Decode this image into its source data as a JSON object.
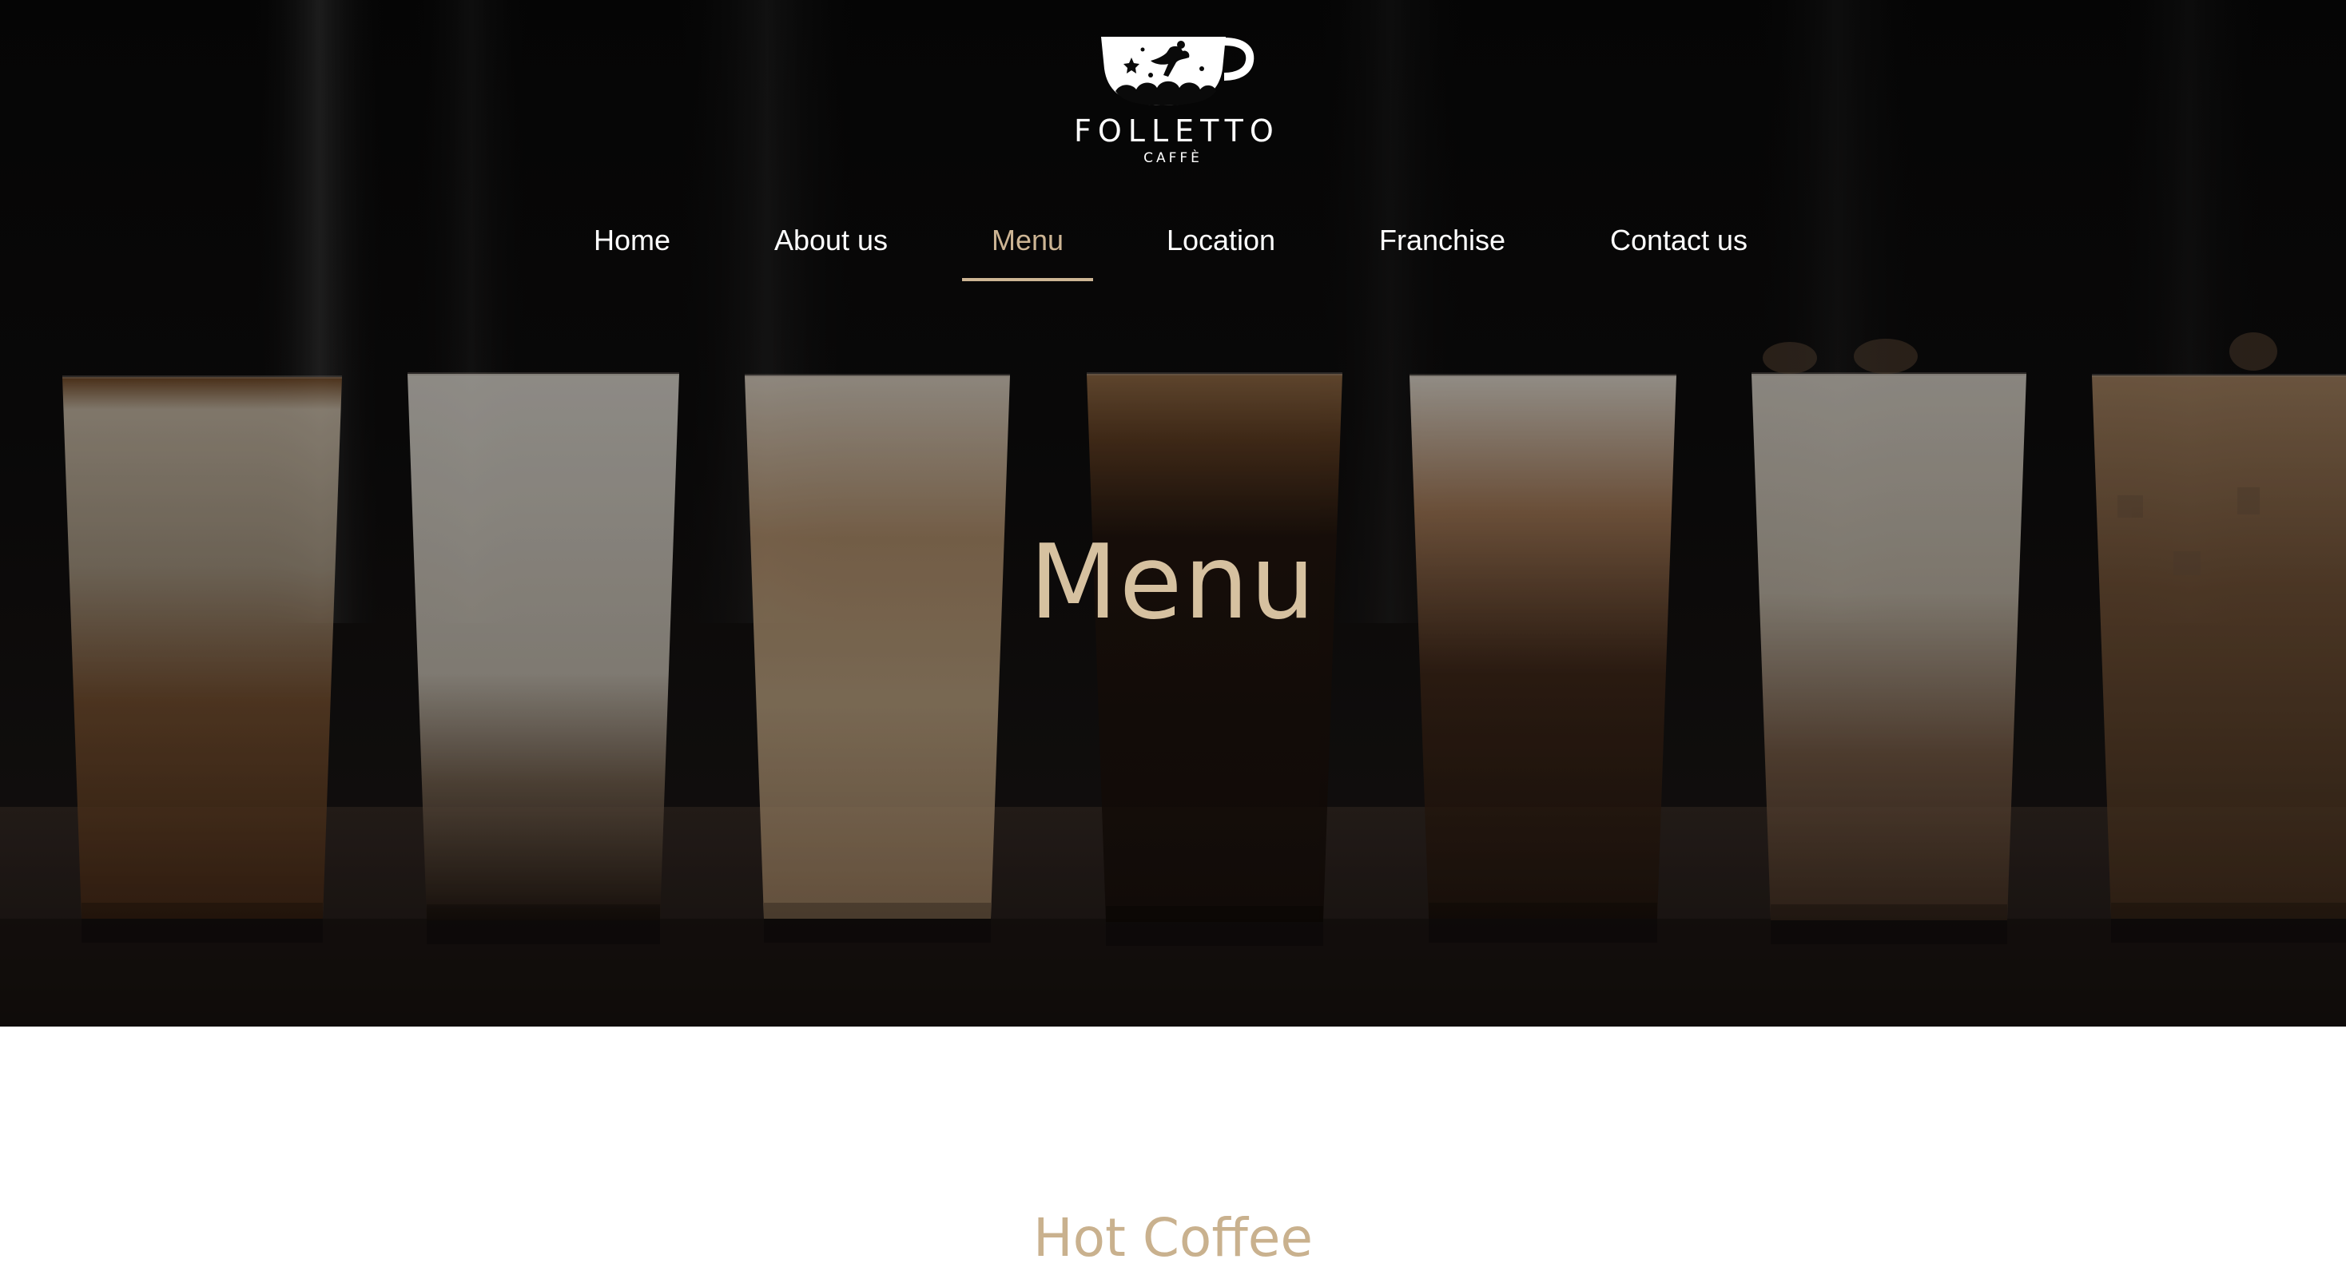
{
  "brand": {
    "name": "FOLLETTO",
    "sub": "CAFFÈ"
  },
  "nav": {
    "items": [
      {
        "label": "Home",
        "active": false
      },
      {
        "label": "About us",
        "active": false
      },
      {
        "label": "Menu",
        "active": true
      },
      {
        "label": "Location",
        "active": false
      },
      {
        "label": "Franchise",
        "active": false
      },
      {
        "label": "Contact us",
        "active": false
      }
    ]
  },
  "hero": {
    "title": "Menu"
  },
  "section": {
    "title": "Hot Coffee"
  },
  "colors": {
    "accent": "#cdb594",
    "hero_title": "#d6c1a0",
    "nav_text": "#ffffff",
    "hero_bg": "#0b0a0a"
  },
  "icons": {
    "logo": "coffee-cup-fairy-icon"
  }
}
